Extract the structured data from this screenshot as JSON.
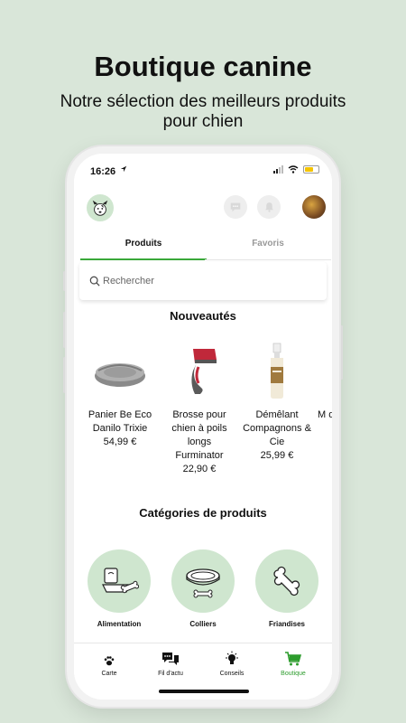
{
  "hero": {
    "title": "Boutique canine",
    "subtitle": "Notre sélection des meilleurs produits pour chien"
  },
  "status_bar": {
    "time": "16:26",
    "battery_color": "#f5c400"
  },
  "header_icons": [
    "dog-logo-icon",
    "chat-icon",
    "bell-icon",
    "user-avatar"
  ],
  "tabs": [
    {
      "label": "Produits",
      "active": true
    },
    {
      "label": "Favoris",
      "active": false
    }
  ],
  "search": {
    "placeholder": "Rechercher"
  },
  "sections": {
    "new": "Nouveautés",
    "categories": "Catégories de produits"
  },
  "products": [
    {
      "name": "Panier Be Eco Danilo Trixie",
      "price": "54,99 €",
      "icon": "dog-bed"
    },
    {
      "name": "Brosse pour chien à poils longs Furminator",
      "price": "22,90 €",
      "icon": "brush"
    },
    {
      "name": "Démêlant Compagnons & Cie",
      "price": "25,99 €",
      "icon": "spray-bottle"
    },
    {
      "name": "M d r",
      "price": "",
      "icon": "partial"
    }
  ],
  "categories": [
    {
      "label": "Alimentation",
      "icon": "food-bowl-icon"
    },
    {
      "label": "Colliers",
      "icon": "collar-icon"
    },
    {
      "label": "Friandises",
      "icon": "bone-icon"
    }
  ],
  "bottom_nav": [
    {
      "label": "Carte",
      "icon": "paw-icon",
      "active": false
    },
    {
      "label": "Fil d'actu",
      "icon": "chat-bubbles-icon",
      "active": false
    },
    {
      "label": "Conseils",
      "icon": "bulb-icon",
      "active": false
    },
    {
      "label": "Boutique",
      "icon": "cart-icon",
      "active": true
    }
  ],
  "colors": {
    "background": "#d9e6d9",
    "accent_green": "#3aa83a",
    "category_circle": "#cfe6cf"
  }
}
